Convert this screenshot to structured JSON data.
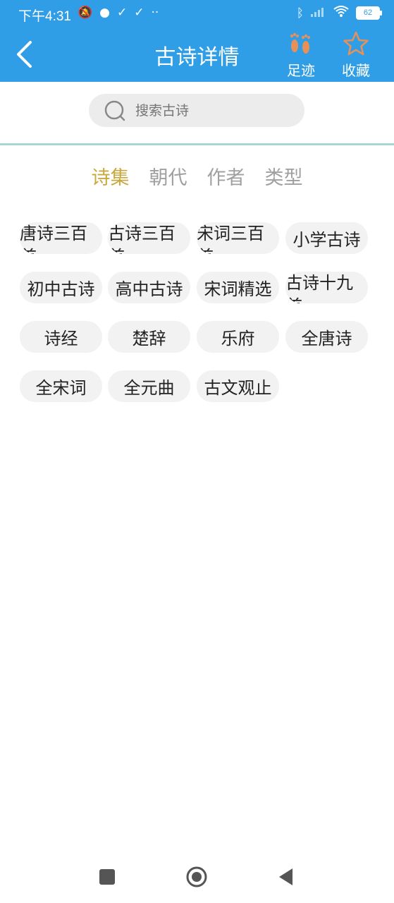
{
  "status": {
    "time": "下午4:31",
    "battery": "62"
  },
  "header": {
    "title": "古诗详情",
    "footprint_label": "足迹",
    "favorite_label": "收藏"
  },
  "search": {
    "placeholder": "搜索古诗"
  },
  "tabs": [
    {
      "label": "诗集",
      "active": true
    },
    {
      "label": "朝代",
      "active": false
    },
    {
      "label": "作者",
      "active": false
    },
    {
      "label": "类型",
      "active": false
    }
  ],
  "collections": [
    "唐诗三百首",
    "古诗三百首",
    "宋词三百首",
    "小学古诗",
    "初中古诗",
    "高中古诗",
    "宋词精选",
    "古诗十九首",
    "诗经",
    "楚辞",
    "乐府",
    "全唐诗",
    "全宋词",
    "全元曲",
    "古文观止"
  ],
  "colors": {
    "primary": "#2f9ee6",
    "active_tab": "#c9a93f",
    "footprint": "#e8905a",
    "star": "#e8905a"
  }
}
